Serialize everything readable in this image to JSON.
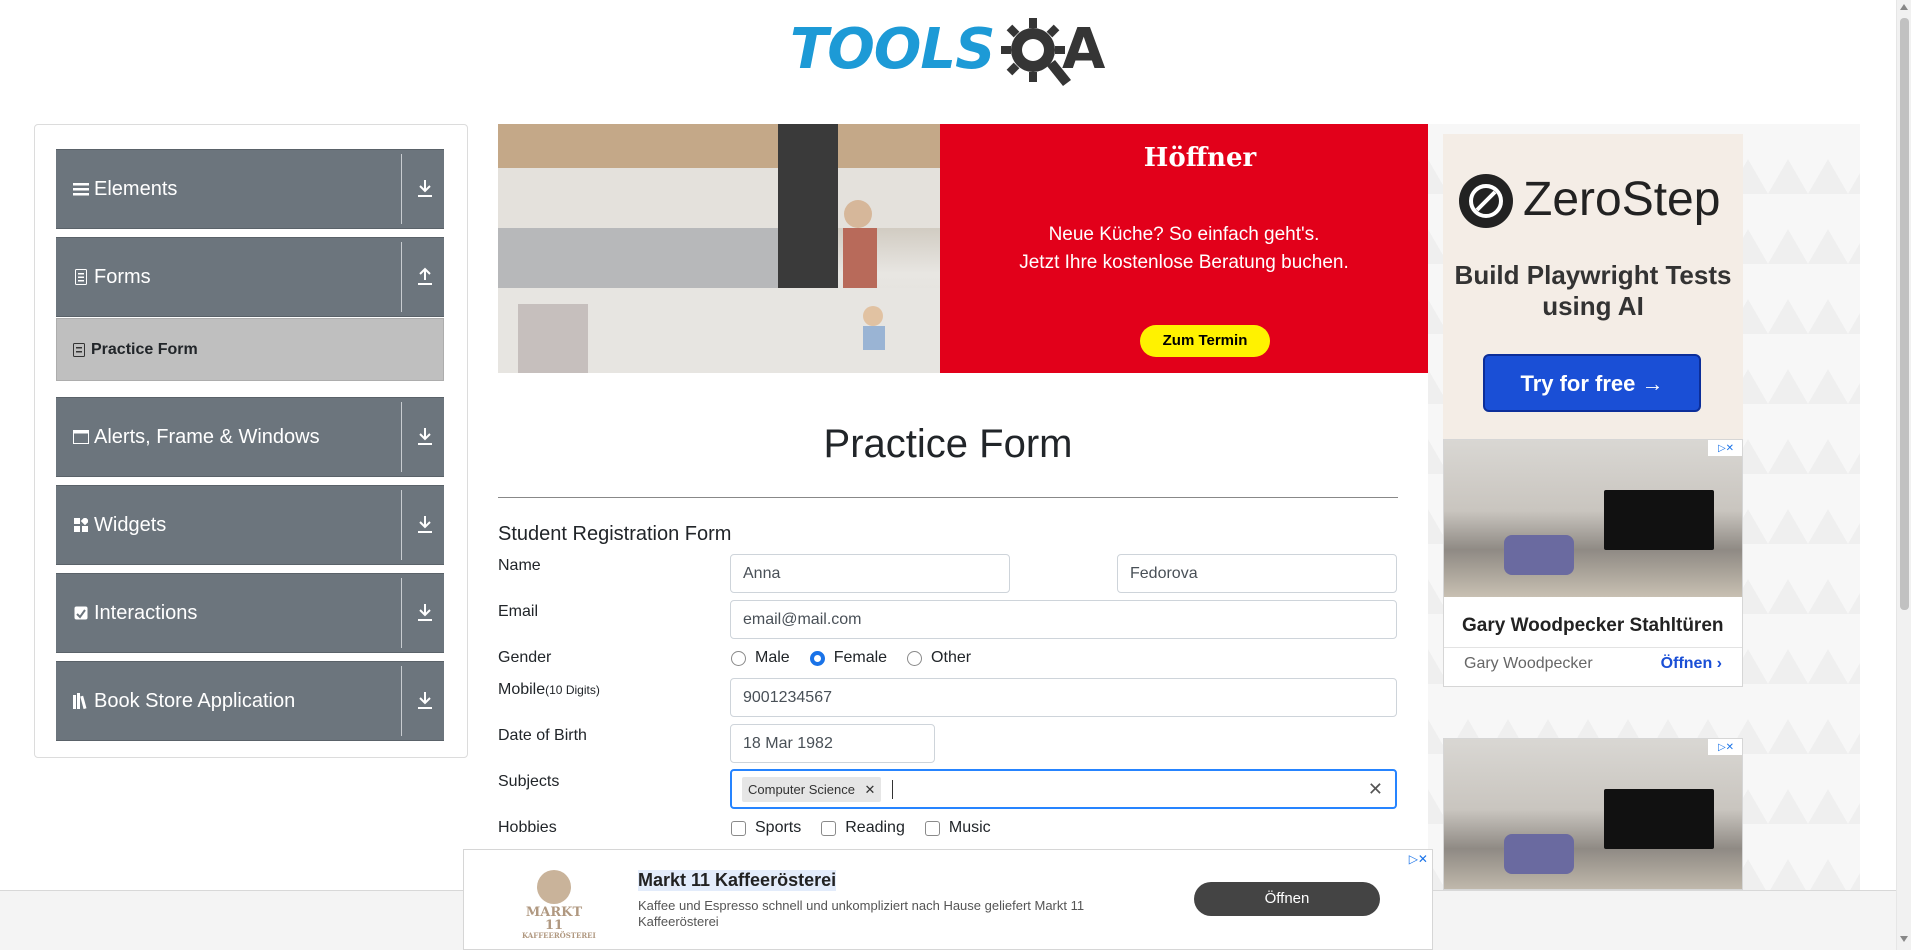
{
  "logo": {
    "text": "TOOLS",
    "a": "A"
  },
  "sidebar": {
    "groups": [
      {
        "label": "Elements",
        "icon": "hamburger-icon",
        "toggle": "download"
      },
      {
        "label": "Forms",
        "icon": "document-icon",
        "toggle": "upload"
      },
      {
        "label": "Alerts, Frame & Windows",
        "icon": "window-icon",
        "toggle": "download"
      },
      {
        "label": "Widgets",
        "icon": "grid-icon",
        "toggle": "download"
      },
      {
        "label": "Interactions",
        "icon": "interaction-icon",
        "toggle": "download"
      },
      {
        "label": "Book Store Application",
        "icon": "books-icon",
        "toggle": "download"
      }
    ],
    "active_item": "Practice Form"
  },
  "top_ad": {
    "brand": "Höffner",
    "line1": "Neue Küche? So einfach geht's.",
    "line2": "Jetzt Ihre kostenlose Beratung buchen.",
    "cta": "Zum Termin"
  },
  "page": {
    "title": "Practice Form",
    "subtitle": "Student Registration Form"
  },
  "form": {
    "name_label": "Name",
    "first_name": "Anna",
    "last_name": "Fedorova",
    "email_label": "Email",
    "email": "email@mail.com",
    "gender_label": "Gender",
    "gender_options": [
      "Male",
      "Female",
      "Other"
    ],
    "gender_selected": "Female",
    "mobile_label": "Mobile",
    "mobile_hint": "(10 Digits)",
    "mobile": "9001234567",
    "dob_label": "Date of Birth",
    "dob": "18 Mar 1982",
    "subjects_label": "Subjects",
    "subjects": [
      "Computer Science"
    ],
    "hobbies_label": "Hobbies",
    "hobbies": [
      "Sports",
      "Reading",
      "Music"
    ]
  },
  "right_ads": {
    "zerostep": {
      "name": "ZeroStep",
      "tagline": "Build Playwright Tests using AI",
      "button": "Try for free →"
    },
    "card": {
      "headline": "Gary Woodpecker Stahltüren",
      "advertiser": "Gary Woodpecker",
      "open": "Öffnen"
    }
  },
  "bottom_ad": {
    "logo_name": "MARKT 11",
    "logo_sub": "KAFFEERÖSTEREI",
    "title": "Markt 11 Kaffeerösterei",
    "desc": "Kaffee und Espresso schnell und unkompliziert nach Hause geliefert Markt 11 Kaffeerösterei",
    "button": "Öffnen"
  },
  "colors": {
    "sidebar_bg": "#6c757d",
    "accent": "#1d9ad6",
    "ad_red": "#e2001a",
    "focus": "#2684ff"
  }
}
